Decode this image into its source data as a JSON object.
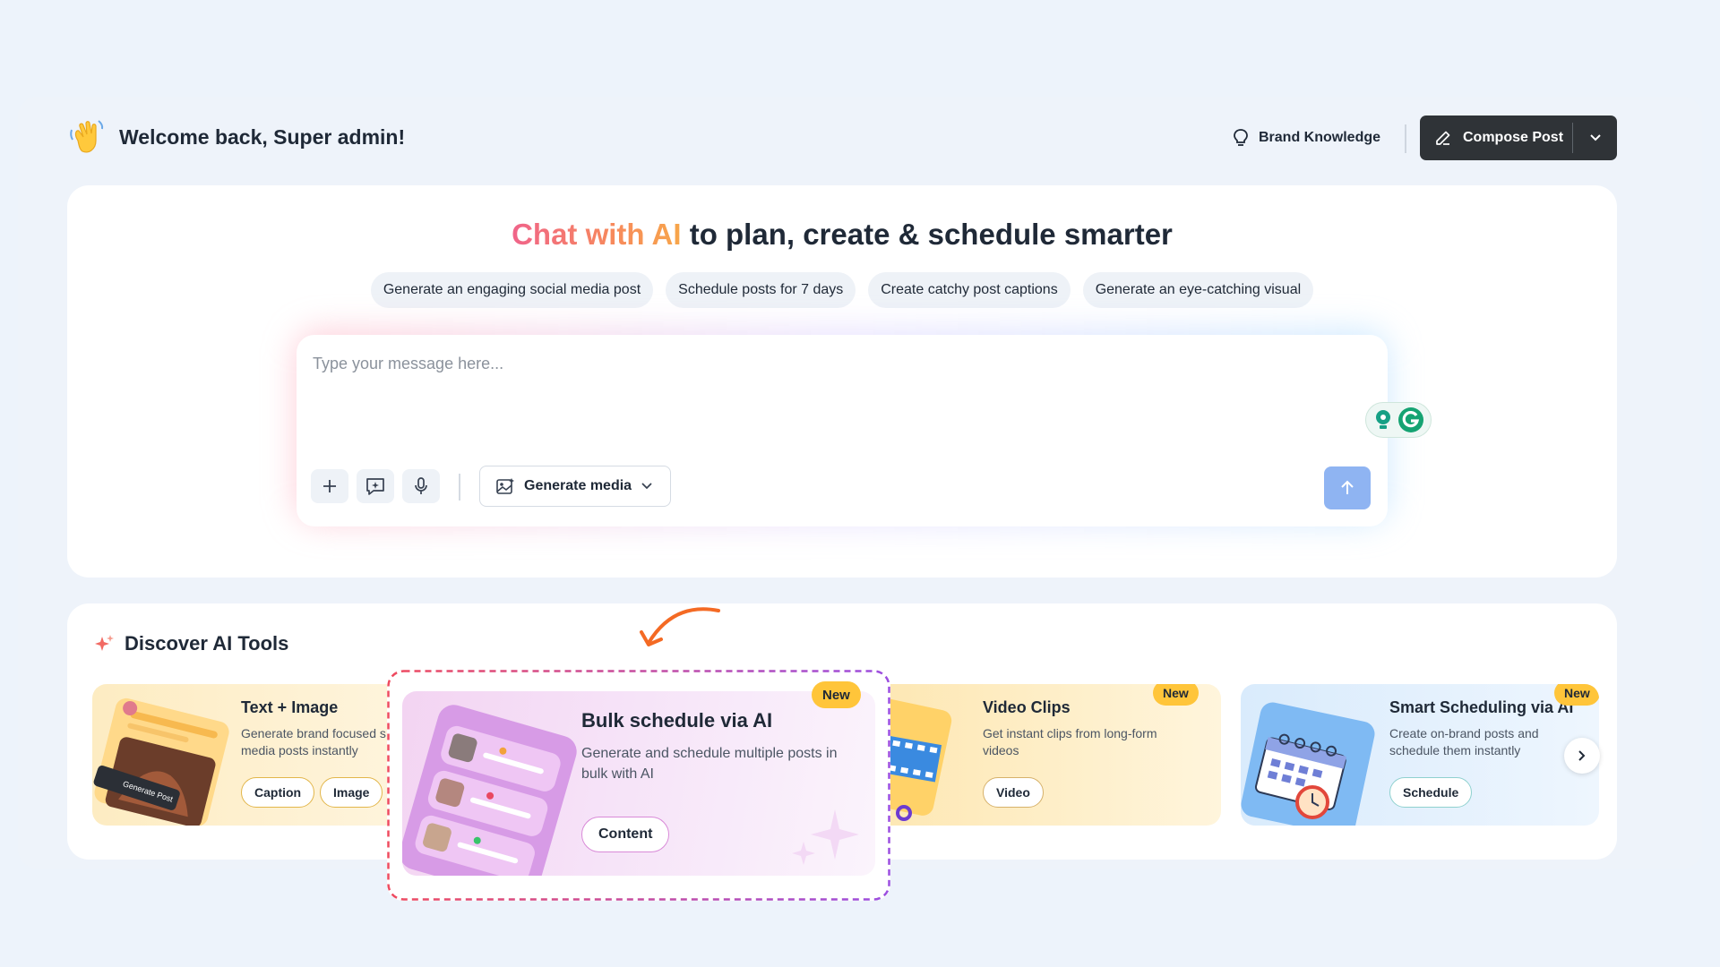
{
  "header": {
    "welcome": "Welcome back, Super admin!",
    "brand_knowledge": "Brand Knowledge",
    "compose": "Compose Post"
  },
  "chat": {
    "headline_highlight": "Chat with AI",
    "headline_rest": " to plan, create & schedule smarter",
    "suggestions": [
      "Generate an engaging social media post",
      "Schedule posts for 7 days",
      "Create catchy post captions",
      "Generate an eye-catching visual"
    ],
    "placeholder": "Type your message here...",
    "generate_media": "Generate media"
  },
  "discover": {
    "title": "Discover AI Tools",
    "tools": [
      {
        "title": "Text + Image",
        "desc_line1": "Generate brand focused s",
        "desc_line2": "media posts instantly",
        "tags": [
          "Caption",
          "Image"
        ],
        "illustration_label": "Generate Post"
      },
      {
        "title": "Bulk schedule via AI",
        "desc_line1": "Generate and schedule multiple posts in",
        "desc_line2": "bulk with AI",
        "tags": [
          "Content"
        ],
        "badge": "New"
      },
      {
        "title": "Video Clips",
        "desc_line1": "Get instant clips from long-form",
        "desc_line2": "videos",
        "tags": [
          "Video"
        ],
        "badge": "New"
      },
      {
        "title": "Smart Scheduling via AI",
        "desc_line1": "Create on-brand posts and",
        "desc_line2": "schedule them instantly",
        "tags": [
          "Schedule"
        ],
        "badge": "New"
      }
    ]
  },
  "colors": {
    "compose_bg": "#2f3337",
    "send_bg": "#8fb4f2",
    "badge_new": "#ffc53a",
    "highlight_dash_start": "#ef4b5f",
    "highlight_dash_end": "#9b4ee0",
    "arrow": "#f46a24"
  },
  "icons": {
    "wave": "waving-hand-icon",
    "brand": "lightbulb-icon",
    "compose": "pencil-icon",
    "caret": "chevron-down-icon",
    "plus": "plus-icon",
    "ai_prompt": "sparkle-chat-icon",
    "mic": "microphone-icon",
    "media": "image-sparkle-icon",
    "send": "arrow-up-icon",
    "discover": "sparkles-icon",
    "next": "chevron-right-icon"
  }
}
